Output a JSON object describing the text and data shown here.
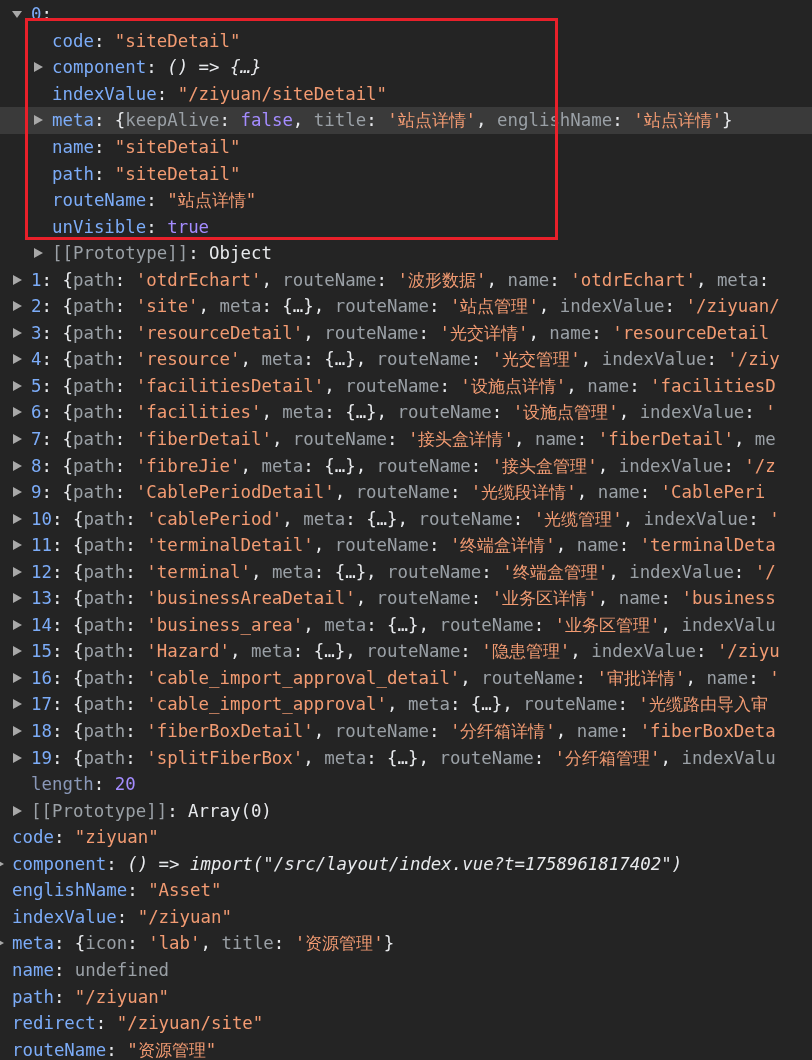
{
  "console": {
    "array_entries": [
      {
        "expanded": true,
        "highlighted": false,
        "tokens": [
          {
            "kind": "index",
            "text": "0"
          },
          {
            "kind": "punct",
            "text": ":"
          }
        ],
        "children": [
          {
            "highlighted": false,
            "tokens": [
              {
                "kind": "key",
                "text": "code"
              },
              {
                "kind": "punct",
                "text": ": "
              },
              {
                "kind": "str",
                "text": "\"siteDetail\""
              }
            ]
          },
          {
            "expanded": false,
            "highlighted": false,
            "tokens": [
              {
                "kind": "key",
                "text": "component"
              },
              {
                "kind": "punct",
                "text": ": "
              },
              {
                "kind": "fn",
                "text": "() => {…}"
              }
            ]
          },
          {
            "highlighted": false,
            "tokens": [
              {
                "kind": "key",
                "text": "indexValue"
              },
              {
                "kind": "punct",
                "text": ": "
              },
              {
                "kind": "str",
                "text": "\"/ziyuan/siteDetail\""
              }
            ]
          },
          {
            "expanded": false,
            "highlighted": true,
            "tokens": [
              {
                "kind": "key",
                "text": "meta"
              },
              {
                "kind": "punct",
                "text": ": {"
              },
              {
                "kind": "dim",
                "text": "keepAlive"
              },
              {
                "kind": "punct",
                "text": ": "
              },
              {
                "kind": "kw",
                "text": "false"
              },
              {
                "kind": "punct",
                "text": ", "
              },
              {
                "kind": "dim",
                "text": "title"
              },
              {
                "kind": "punct",
                "text": ": "
              },
              {
                "kind": "str",
                "text": "'站点详情'"
              },
              {
                "kind": "punct",
                "text": ", "
              },
              {
                "kind": "dim",
                "text": "englishName"
              },
              {
                "kind": "punct",
                "text": ": "
              },
              {
                "kind": "str",
                "text": "'站点详情'"
              },
              {
                "kind": "punct",
                "text": "}"
              }
            ]
          },
          {
            "highlighted": false,
            "tokens": [
              {
                "kind": "key",
                "text": "name"
              },
              {
                "kind": "punct",
                "text": ": "
              },
              {
                "kind": "str",
                "text": "\"siteDetail\""
              }
            ]
          },
          {
            "highlighted": false,
            "tokens": [
              {
                "kind": "key",
                "text": "path"
              },
              {
                "kind": "punct",
                "text": ": "
              },
              {
                "kind": "str",
                "text": "\"siteDetail\""
              }
            ]
          },
          {
            "highlighted": false,
            "tokens": [
              {
                "kind": "key",
                "text": "routeName"
              },
              {
                "kind": "punct",
                "text": ": "
              },
              {
                "kind": "str",
                "text": "\"站点详情\""
              }
            ]
          },
          {
            "highlighted": false,
            "tokens": [
              {
                "kind": "key",
                "text": "unVisible"
              },
              {
                "kind": "punct",
                "text": ": "
              },
              {
                "kind": "kw",
                "text": "true"
              }
            ]
          },
          {
            "expanded": false,
            "highlighted": false,
            "tokens": [
              {
                "kind": "dim",
                "text": "[[Prototype]]"
              },
              {
                "kind": "punct",
                "text": ": Object"
              }
            ]
          }
        ]
      },
      {
        "expanded": false,
        "highlighted": false,
        "tokens": [
          {
            "kind": "index",
            "text": "1"
          },
          {
            "kind": "punct",
            "text": ": {"
          },
          {
            "kind": "dim",
            "text": "path"
          },
          {
            "kind": "punct",
            "text": ": "
          },
          {
            "kind": "str",
            "text": "'otdrEchart'"
          },
          {
            "kind": "punct",
            "text": ", "
          },
          {
            "kind": "dim",
            "text": "routeName"
          },
          {
            "kind": "punct",
            "text": ": "
          },
          {
            "kind": "str",
            "text": "'波形数据'"
          },
          {
            "kind": "punct",
            "text": ", "
          },
          {
            "kind": "dim",
            "text": "name"
          },
          {
            "kind": "punct",
            "text": ": "
          },
          {
            "kind": "str",
            "text": "'otdrEchart'"
          },
          {
            "kind": "punct",
            "text": ", "
          },
          {
            "kind": "dim",
            "text": "meta"
          },
          {
            "kind": "punct",
            "text": ":"
          }
        ]
      },
      {
        "expanded": false,
        "highlighted": false,
        "tokens": [
          {
            "kind": "index",
            "text": "2"
          },
          {
            "kind": "punct",
            "text": ": {"
          },
          {
            "kind": "dim",
            "text": "path"
          },
          {
            "kind": "punct",
            "text": ": "
          },
          {
            "kind": "str",
            "text": "'site'"
          },
          {
            "kind": "punct",
            "text": ", "
          },
          {
            "kind": "dim",
            "text": "meta"
          },
          {
            "kind": "punct",
            "text": ": {…}, "
          },
          {
            "kind": "dim",
            "text": "routeName"
          },
          {
            "kind": "punct",
            "text": ": "
          },
          {
            "kind": "str",
            "text": "'站点管理'"
          },
          {
            "kind": "punct",
            "text": ", "
          },
          {
            "kind": "dim",
            "text": "indexValue"
          },
          {
            "kind": "punct",
            "text": ": "
          },
          {
            "kind": "str",
            "text": "'/ziyuan/"
          }
        ]
      },
      {
        "expanded": false,
        "highlighted": false,
        "tokens": [
          {
            "kind": "index",
            "text": "3"
          },
          {
            "kind": "punct",
            "text": ": {"
          },
          {
            "kind": "dim",
            "text": "path"
          },
          {
            "kind": "punct",
            "text": ": "
          },
          {
            "kind": "str",
            "text": "'resourceDetail'"
          },
          {
            "kind": "punct",
            "text": ", "
          },
          {
            "kind": "dim",
            "text": "routeName"
          },
          {
            "kind": "punct",
            "text": ": "
          },
          {
            "kind": "str",
            "text": "'光交详情'"
          },
          {
            "kind": "punct",
            "text": ", "
          },
          {
            "kind": "dim",
            "text": "name"
          },
          {
            "kind": "punct",
            "text": ": "
          },
          {
            "kind": "str",
            "text": "'resourceDetail"
          }
        ]
      },
      {
        "expanded": false,
        "highlighted": false,
        "tokens": [
          {
            "kind": "index",
            "text": "4"
          },
          {
            "kind": "punct",
            "text": ": {"
          },
          {
            "kind": "dim",
            "text": "path"
          },
          {
            "kind": "punct",
            "text": ": "
          },
          {
            "kind": "str",
            "text": "'resource'"
          },
          {
            "kind": "punct",
            "text": ", "
          },
          {
            "kind": "dim",
            "text": "meta"
          },
          {
            "kind": "punct",
            "text": ": {…}, "
          },
          {
            "kind": "dim",
            "text": "routeName"
          },
          {
            "kind": "punct",
            "text": ": "
          },
          {
            "kind": "str",
            "text": "'光交管理'"
          },
          {
            "kind": "punct",
            "text": ", "
          },
          {
            "kind": "dim",
            "text": "indexValue"
          },
          {
            "kind": "punct",
            "text": ": "
          },
          {
            "kind": "str",
            "text": "'/ziy"
          }
        ]
      },
      {
        "expanded": false,
        "highlighted": false,
        "tokens": [
          {
            "kind": "index",
            "text": "5"
          },
          {
            "kind": "punct",
            "text": ": {"
          },
          {
            "kind": "dim",
            "text": "path"
          },
          {
            "kind": "punct",
            "text": ": "
          },
          {
            "kind": "str",
            "text": "'facilitiesDetail'"
          },
          {
            "kind": "punct",
            "text": ", "
          },
          {
            "kind": "dim",
            "text": "routeName"
          },
          {
            "kind": "punct",
            "text": ": "
          },
          {
            "kind": "str",
            "text": "'设施点详情'"
          },
          {
            "kind": "punct",
            "text": ", "
          },
          {
            "kind": "dim",
            "text": "name"
          },
          {
            "kind": "punct",
            "text": ": "
          },
          {
            "kind": "str",
            "text": "'facilitiesD"
          }
        ]
      },
      {
        "expanded": false,
        "highlighted": false,
        "tokens": [
          {
            "kind": "index",
            "text": "6"
          },
          {
            "kind": "punct",
            "text": ": {"
          },
          {
            "kind": "dim",
            "text": "path"
          },
          {
            "kind": "punct",
            "text": ": "
          },
          {
            "kind": "str",
            "text": "'facilities'"
          },
          {
            "kind": "punct",
            "text": ", "
          },
          {
            "kind": "dim",
            "text": "meta"
          },
          {
            "kind": "punct",
            "text": ": {…}, "
          },
          {
            "kind": "dim",
            "text": "routeName"
          },
          {
            "kind": "punct",
            "text": ": "
          },
          {
            "kind": "str",
            "text": "'设施点管理'"
          },
          {
            "kind": "punct",
            "text": ", "
          },
          {
            "kind": "dim",
            "text": "indexValue"
          },
          {
            "kind": "punct",
            "text": ": "
          },
          {
            "kind": "str",
            "text": "'"
          }
        ]
      },
      {
        "expanded": false,
        "highlighted": false,
        "tokens": [
          {
            "kind": "index",
            "text": "7"
          },
          {
            "kind": "punct",
            "text": ": {"
          },
          {
            "kind": "dim",
            "text": "path"
          },
          {
            "kind": "punct",
            "text": ": "
          },
          {
            "kind": "str",
            "text": "'fiberDetail'"
          },
          {
            "kind": "punct",
            "text": ", "
          },
          {
            "kind": "dim",
            "text": "routeName"
          },
          {
            "kind": "punct",
            "text": ": "
          },
          {
            "kind": "str",
            "text": "'接头盒详情'"
          },
          {
            "kind": "punct",
            "text": ", "
          },
          {
            "kind": "dim",
            "text": "name"
          },
          {
            "kind": "punct",
            "text": ": "
          },
          {
            "kind": "str",
            "text": "'fiberDetail'"
          },
          {
            "kind": "punct",
            "text": ", "
          },
          {
            "kind": "dim",
            "text": "me"
          }
        ]
      },
      {
        "expanded": false,
        "highlighted": false,
        "tokens": [
          {
            "kind": "index",
            "text": "8"
          },
          {
            "kind": "punct",
            "text": ": {"
          },
          {
            "kind": "dim",
            "text": "path"
          },
          {
            "kind": "punct",
            "text": ": "
          },
          {
            "kind": "str",
            "text": "'fibreJie'"
          },
          {
            "kind": "punct",
            "text": ", "
          },
          {
            "kind": "dim",
            "text": "meta"
          },
          {
            "kind": "punct",
            "text": ": {…}, "
          },
          {
            "kind": "dim",
            "text": "routeName"
          },
          {
            "kind": "punct",
            "text": ": "
          },
          {
            "kind": "str",
            "text": "'接头盒管理'"
          },
          {
            "kind": "punct",
            "text": ", "
          },
          {
            "kind": "dim",
            "text": "indexValue"
          },
          {
            "kind": "punct",
            "text": ": "
          },
          {
            "kind": "str",
            "text": "'/z"
          }
        ]
      },
      {
        "expanded": false,
        "highlighted": false,
        "tokens": [
          {
            "kind": "index",
            "text": "9"
          },
          {
            "kind": "punct",
            "text": ": {"
          },
          {
            "kind": "dim",
            "text": "path"
          },
          {
            "kind": "punct",
            "text": ": "
          },
          {
            "kind": "str",
            "text": "'CablePeriodDetail'"
          },
          {
            "kind": "punct",
            "text": ", "
          },
          {
            "kind": "dim",
            "text": "routeName"
          },
          {
            "kind": "punct",
            "text": ": "
          },
          {
            "kind": "str",
            "text": "'光缆段详情'"
          },
          {
            "kind": "punct",
            "text": ", "
          },
          {
            "kind": "dim",
            "text": "name"
          },
          {
            "kind": "punct",
            "text": ": "
          },
          {
            "kind": "str",
            "text": "'CablePeri"
          }
        ]
      },
      {
        "expanded": false,
        "highlighted": false,
        "tokens": [
          {
            "kind": "index",
            "text": "10"
          },
          {
            "kind": "punct",
            "text": ": {"
          },
          {
            "kind": "dim",
            "text": "path"
          },
          {
            "kind": "punct",
            "text": ": "
          },
          {
            "kind": "str",
            "text": "'cablePeriod'"
          },
          {
            "kind": "punct",
            "text": ", "
          },
          {
            "kind": "dim",
            "text": "meta"
          },
          {
            "kind": "punct",
            "text": ": {…}, "
          },
          {
            "kind": "dim",
            "text": "routeName"
          },
          {
            "kind": "punct",
            "text": ": "
          },
          {
            "kind": "str",
            "text": "'光缆管理'"
          },
          {
            "kind": "punct",
            "text": ", "
          },
          {
            "kind": "dim",
            "text": "indexValue"
          },
          {
            "kind": "punct",
            "text": ": "
          },
          {
            "kind": "str",
            "text": "'"
          }
        ]
      },
      {
        "expanded": false,
        "highlighted": false,
        "tokens": [
          {
            "kind": "index",
            "text": "11"
          },
          {
            "kind": "punct",
            "text": ": {"
          },
          {
            "kind": "dim",
            "text": "path"
          },
          {
            "kind": "punct",
            "text": ": "
          },
          {
            "kind": "str",
            "text": "'terminalDetail'"
          },
          {
            "kind": "punct",
            "text": ", "
          },
          {
            "kind": "dim",
            "text": "routeName"
          },
          {
            "kind": "punct",
            "text": ": "
          },
          {
            "kind": "str",
            "text": "'终端盒详情'"
          },
          {
            "kind": "punct",
            "text": ", "
          },
          {
            "kind": "dim",
            "text": "name"
          },
          {
            "kind": "punct",
            "text": ": "
          },
          {
            "kind": "str",
            "text": "'terminalDeta"
          }
        ]
      },
      {
        "expanded": false,
        "highlighted": false,
        "tokens": [
          {
            "kind": "index",
            "text": "12"
          },
          {
            "kind": "punct",
            "text": ": {"
          },
          {
            "kind": "dim",
            "text": "path"
          },
          {
            "kind": "punct",
            "text": ": "
          },
          {
            "kind": "str",
            "text": "'terminal'"
          },
          {
            "kind": "punct",
            "text": ", "
          },
          {
            "kind": "dim",
            "text": "meta"
          },
          {
            "kind": "punct",
            "text": ": {…}, "
          },
          {
            "kind": "dim",
            "text": "routeName"
          },
          {
            "kind": "punct",
            "text": ": "
          },
          {
            "kind": "str",
            "text": "'终端盒管理'"
          },
          {
            "kind": "punct",
            "text": ", "
          },
          {
            "kind": "dim",
            "text": "indexValue"
          },
          {
            "kind": "punct",
            "text": ": "
          },
          {
            "kind": "str",
            "text": "'/"
          }
        ]
      },
      {
        "expanded": false,
        "highlighted": false,
        "tokens": [
          {
            "kind": "index",
            "text": "13"
          },
          {
            "kind": "punct",
            "text": ": {"
          },
          {
            "kind": "dim",
            "text": "path"
          },
          {
            "kind": "punct",
            "text": ": "
          },
          {
            "kind": "str",
            "text": "'businessAreaDetail'"
          },
          {
            "kind": "punct",
            "text": ", "
          },
          {
            "kind": "dim",
            "text": "routeName"
          },
          {
            "kind": "punct",
            "text": ": "
          },
          {
            "kind": "str",
            "text": "'业务区详情'"
          },
          {
            "kind": "punct",
            "text": ", "
          },
          {
            "kind": "dim",
            "text": "name"
          },
          {
            "kind": "punct",
            "text": ": "
          },
          {
            "kind": "str",
            "text": "'business"
          }
        ]
      },
      {
        "expanded": false,
        "highlighted": false,
        "tokens": [
          {
            "kind": "index",
            "text": "14"
          },
          {
            "kind": "punct",
            "text": ": {"
          },
          {
            "kind": "dim",
            "text": "path"
          },
          {
            "kind": "punct",
            "text": ": "
          },
          {
            "kind": "str",
            "text": "'business_area'"
          },
          {
            "kind": "punct",
            "text": ", "
          },
          {
            "kind": "dim",
            "text": "meta"
          },
          {
            "kind": "punct",
            "text": ": {…}, "
          },
          {
            "kind": "dim",
            "text": "routeName"
          },
          {
            "kind": "punct",
            "text": ": "
          },
          {
            "kind": "str",
            "text": "'业务区管理'"
          },
          {
            "kind": "punct",
            "text": ", "
          },
          {
            "kind": "dim",
            "text": "indexValu"
          }
        ]
      },
      {
        "expanded": false,
        "highlighted": false,
        "tokens": [
          {
            "kind": "index",
            "text": "15"
          },
          {
            "kind": "punct",
            "text": ": {"
          },
          {
            "kind": "dim",
            "text": "path"
          },
          {
            "kind": "punct",
            "text": ": "
          },
          {
            "kind": "str",
            "text": "'Hazard'"
          },
          {
            "kind": "punct",
            "text": ", "
          },
          {
            "kind": "dim",
            "text": "meta"
          },
          {
            "kind": "punct",
            "text": ": {…}, "
          },
          {
            "kind": "dim",
            "text": "routeName"
          },
          {
            "kind": "punct",
            "text": ": "
          },
          {
            "kind": "str",
            "text": "'隐患管理'"
          },
          {
            "kind": "punct",
            "text": ", "
          },
          {
            "kind": "dim",
            "text": "indexValue"
          },
          {
            "kind": "punct",
            "text": ": "
          },
          {
            "kind": "str",
            "text": "'/ziyu"
          }
        ]
      },
      {
        "expanded": false,
        "highlighted": false,
        "tokens": [
          {
            "kind": "index",
            "text": "16"
          },
          {
            "kind": "punct",
            "text": ": {"
          },
          {
            "kind": "dim",
            "text": "path"
          },
          {
            "kind": "punct",
            "text": ": "
          },
          {
            "kind": "str",
            "text": "'cable_import_approval_detail'"
          },
          {
            "kind": "punct",
            "text": ", "
          },
          {
            "kind": "dim",
            "text": "routeName"
          },
          {
            "kind": "punct",
            "text": ": "
          },
          {
            "kind": "str",
            "text": "'审批详情'"
          },
          {
            "kind": "punct",
            "text": ", "
          },
          {
            "kind": "dim",
            "text": "name"
          },
          {
            "kind": "punct",
            "text": ": "
          },
          {
            "kind": "str",
            "text": "'"
          }
        ]
      },
      {
        "expanded": false,
        "highlighted": false,
        "tokens": [
          {
            "kind": "index",
            "text": "17"
          },
          {
            "kind": "punct",
            "text": ": {"
          },
          {
            "kind": "dim",
            "text": "path"
          },
          {
            "kind": "punct",
            "text": ": "
          },
          {
            "kind": "str",
            "text": "'cable_import_approval'"
          },
          {
            "kind": "punct",
            "text": ", "
          },
          {
            "kind": "dim",
            "text": "meta"
          },
          {
            "kind": "punct",
            "text": ": {…}, "
          },
          {
            "kind": "dim",
            "text": "routeName"
          },
          {
            "kind": "punct",
            "text": ": "
          },
          {
            "kind": "str",
            "text": "'光缆路由导入审"
          }
        ]
      },
      {
        "expanded": false,
        "highlighted": false,
        "tokens": [
          {
            "kind": "index",
            "text": "18"
          },
          {
            "kind": "punct",
            "text": ": {"
          },
          {
            "kind": "dim",
            "text": "path"
          },
          {
            "kind": "punct",
            "text": ": "
          },
          {
            "kind": "str",
            "text": "'fiberBoxDetail'"
          },
          {
            "kind": "punct",
            "text": ", "
          },
          {
            "kind": "dim",
            "text": "routeName"
          },
          {
            "kind": "punct",
            "text": ": "
          },
          {
            "kind": "str",
            "text": "'分纤箱详情'"
          },
          {
            "kind": "punct",
            "text": ", "
          },
          {
            "kind": "dim",
            "text": "name"
          },
          {
            "kind": "punct",
            "text": ": "
          },
          {
            "kind": "str",
            "text": "'fiberBoxDeta"
          }
        ]
      },
      {
        "expanded": false,
        "highlighted": false,
        "tokens": [
          {
            "kind": "index",
            "text": "19"
          },
          {
            "kind": "punct",
            "text": ": {"
          },
          {
            "kind": "dim",
            "text": "path"
          },
          {
            "kind": "punct",
            "text": ": "
          },
          {
            "kind": "str",
            "text": "'splitFiberBox'"
          },
          {
            "kind": "punct",
            "text": ", "
          },
          {
            "kind": "dim",
            "text": "meta"
          },
          {
            "kind": "punct",
            "text": ": {…}, "
          },
          {
            "kind": "dim",
            "text": "routeName"
          },
          {
            "kind": "punct",
            "text": ": "
          },
          {
            "kind": "str",
            "text": "'分纤箱管理'"
          },
          {
            "kind": "punct",
            "text": ", "
          },
          {
            "kind": "dim",
            "text": "indexValu"
          }
        ]
      },
      {
        "highlighted": false,
        "tokens": [
          {
            "kind": "dimkey",
            "text": "length"
          },
          {
            "kind": "punct",
            "text": ": "
          },
          {
            "kind": "kw",
            "text": "20"
          }
        ]
      },
      {
        "expanded": false,
        "highlighted": false,
        "tokens": [
          {
            "kind": "dim",
            "text": "[[Prototype]]"
          },
          {
            "kind": "punct",
            "text": ": Array(0)"
          }
        ]
      }
    ],
    "properties": [
      {
        "highlighted": false,
        "tokens": [
          {
            "kind": "key",
            "text": "code"
          },
          {
            "kind": "punct",
            "text": ": "
          },
          {
            "kind": "str",
            "text": "\"ziyuan\""
          }
        ]
      },
      {
        "expanded": false,
        "highlighted": false,
        "tokens": [
          {
            "kind": "key",
            "text": "component"
          },
          {
            "kind": "punct",
            "text": ": "
          },
          {
            "kind": "fn",
            "text": "() => import(\"/src/layout/index.vue?t=1758961817402\")"
          }
        ]
      },
      {
        "highlighted": false,
        "tokens": [
          {
            "kind": "key",
            "text": "englishName"
          },
          {
            "kind": "punct",
            "text": ": "
          },
          {
            "kind": "str",
            "text": "\"Asset\""
          }
        ]
      },
      {
        "highlighted": false,
        "tokens": [
          {
            "kind": "key",
            "text": "indexValue"
          },
          {
            "kind": "punct",
            "text": ": "
          },
          {
            "kind": "str",
            "text": "\"/ziyuan\""
          }
        ]
      },
      {
        "expanded": false,
        "highlighted": false,
        "tokens": [
          {
            "kind": "key",
            "text": "meta"
          },
          {
            "kind": "punct",
            "text": ": {"
          },
          {
            "kind": "dim",
            "text": "icon"
          },
          {
            "kind": "punct",
            "text": ": "
          },
          {
            "kind": "str",
            "text": "'lab'"
          },
          {
            "kind": "punct",
            "text": ", "
          },
          {
            "kind": "dim",
            "text": "title"
          },
          {
            "kind": "punct",
            "text": ": "
          },
          {
            "kind": "str",
            "text": "'资源管理'"
          },
          {
            "kind": "punct",
            "text": "}"
          }
        ]
      },
      {
        "highlighted": false,
        "tokens": [
          {
            "kind": "key",
            "text": "name"
          },
          {
            "kind": "punct",
            "text": ": "
          },
          {
            "kind": "dim",
            "text": "undefined"
          }
        ]
      },
      {
        "highlighted": false,
        "tokens": [
          {
            "kind": "key",
            "text": "path"
          },
          {
            "kind": "punct",
            "text": ": "
          },
          {
            "kind": "str",
            "text": "\"/ziyuan\""
          }
        ]
      },
      {
        "highlighted": false,
        "tokens": [
          {
            "kind": "key",
            "text": "redirect"
          },
          {
            "kind": "punct",
            "text": ": "
          },
          {
            "kind": "str",
            "text": "\"/ziyuan/site\""
          }
        ]
      },
      {
        "highlighted": false,
        "tokens": [
          {
            "kind": "key",
            "text": "routeName"
          },
          {
            "kind": "punct",
            "text": ": "
          },
          {
            "kind": "str",
            "text": "\"资源管理\""
          }
        ]
      }
    ]
  }
}
